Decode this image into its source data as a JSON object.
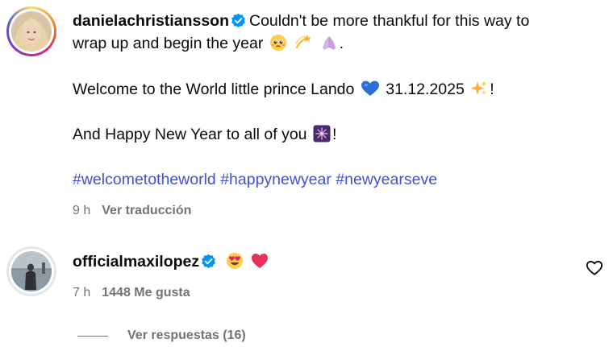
{
  "post": {
    "username": "danielachristiansson",
    "caption_line1": "Couldn't be more thankful for this way to",
    "caption_line2": "wrap up and begin the year",
    "caption_line2_end": ".",
    "caption_welcome": "Welcome to the World little prince Lando",
    "caption_date": "31.12.2025",
    "caption_welcome_end": "!",
    "caption_newyear": "And Happy New Year to all of you",
    "caption_newyear_end": "!",
    "hashtags": [
      "#welcometotheworld",
      "#happynewyear",
      "#newyearseve"
    ],
    "time": "9 h",
    "translate_label": "Ver traducción",
    "emojis": [
      "pleading-face-emoji",
      "dizzy-emoji",
      "folded-hands-emoji",
      "blue-heart-emoji",
      "sparkles-emoji",
      "fireworks-emoji"
    ]
  },
  "comment": {
    "username": "officialmaxilopez",
    "emojis": [
      "heart-eyes-smiling-face-emoji",
      "red-heart-emoji"
    ],
    "time": "7 h",
    "likes_label": "1448 Me gusta",
    "replies_label": "Ver respuestas (16)"
  },
  "colors": {
    "hashtag": "#3f51d8",
    "verified": "#0095f6",
    "meta": "#737373"
  }
}
